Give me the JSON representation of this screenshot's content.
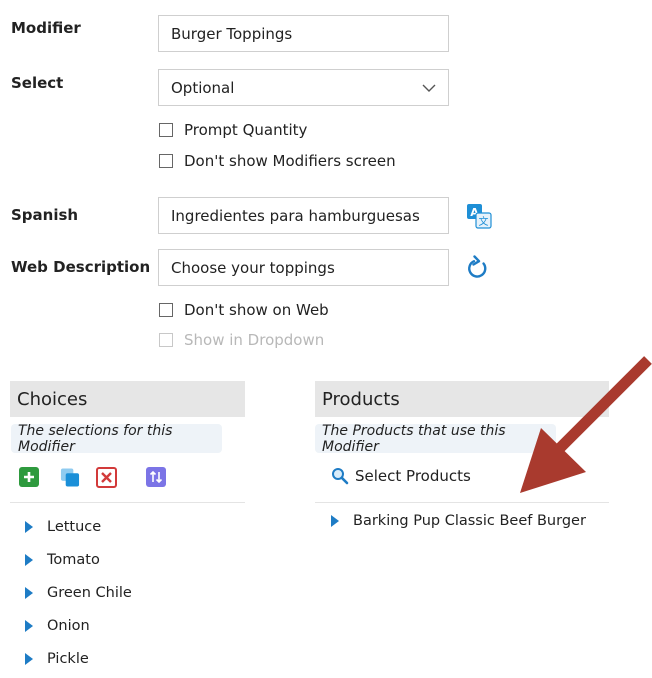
{
  "form": {
    "modifier_label": "Modifier",
    "modifier_value": "Burger Toppings",
    "select_label": "Select",
    "select_value": "Optional",
    "prompt_quantity": "Prompt Quantity",
    "dont_show_modifiers": "Don't show Modifiers screen",
    "spanish_label": "Spanish",
    "spanish_value": "Ingredientes para hamburguesas",
    "web_desc_label": "Web Description",
    "web_desc_value": "Choose your toppings",
    "dont_show_web": "Don't show on Web",
    "show_in_dropdown": "Show in Dropdown"
  },
  "choices": {
    "title": "Choices",
    "hint": "The selections for this Modifier",
    "items": [
      "Lettuce",
      "Tomato",
      "Green Chile",
      "Onion",
      "Pickle"
    ]
  },
  "products": {
    "title": "Products",
    "hint": "The Products that use this Modifier",
    "select_label": "Select Products",
    "items": [
      "Barking Pup Classic Beef Burger"
    ]
  },
  "colors": {
    "accent_blue": "#1e7cc5",
    "add_green": "#2e9a3e",
    "delete_red": "#d23a3a",
    "sort_purple": "#6f6ae0",
    "arrow_red": "#a93a2e"
  }
}
